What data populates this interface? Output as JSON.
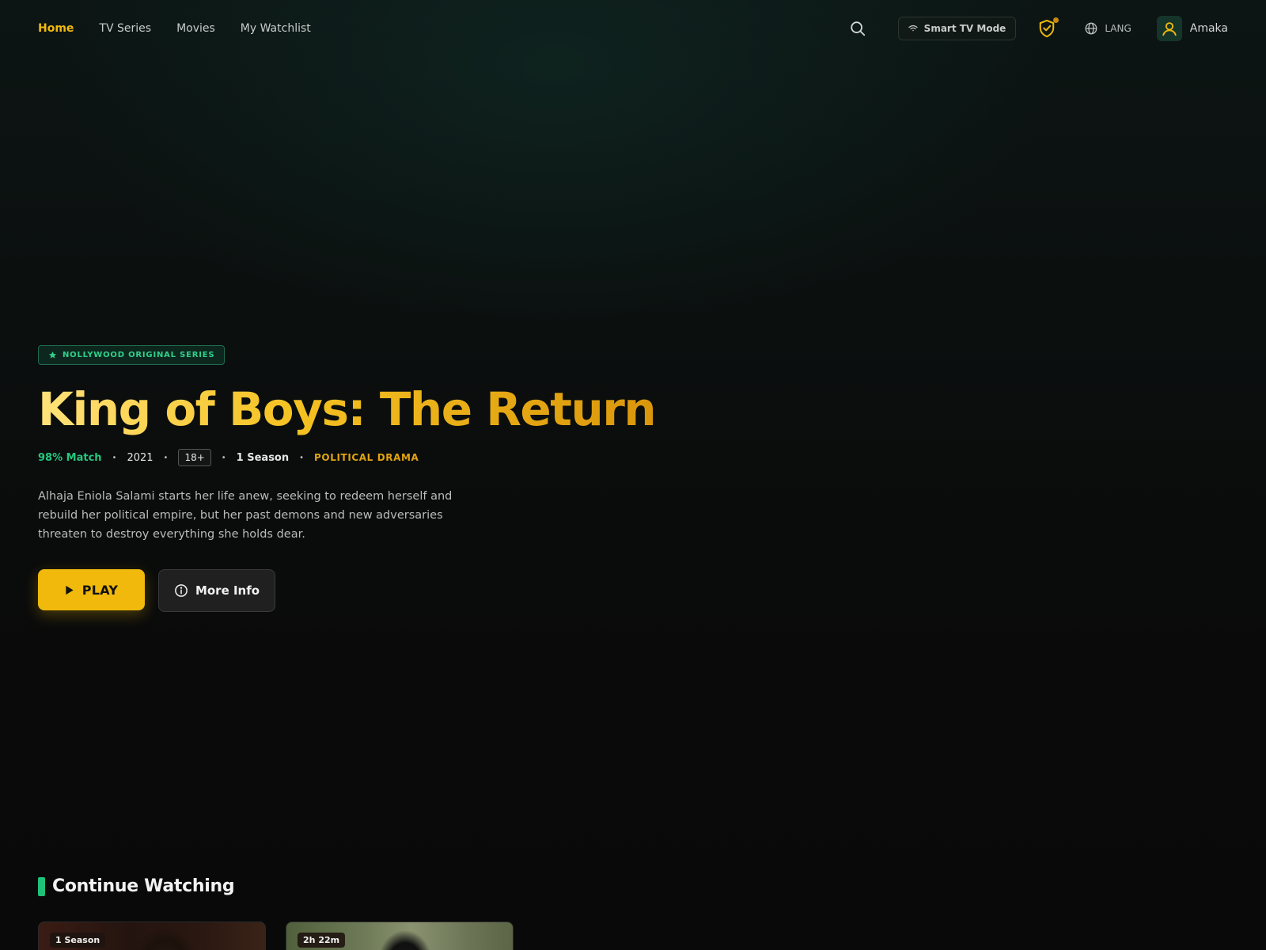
{
  "nav": {
    "items": [
      {
        "label": "Home",
        "active": true
      },
      {
        "label": "TV Series",
        "active": false
      },
      {
        "label": "Movies",
        "active": false
      },
      {
        "label": "My Watchlist",
        "active": false
      }
    ]
  },
  "header": {
    "search_icon": "search-icon",
    "tv_mode_label": "Smart TV Mode",
    "tv_mode_icon": "wifi-icon",
    "shield_icon": "shield-check-icon",
    "lang_label": "LANG",
    "lang_icon": "globe-icon",
    "user_name": "Amaka",
    "avatar_icon": "user-icon"
  },
  "hero": {
    "badge": "NOLLYWOOD ORIGINAL SERIES",
    "badge_icon": "star-icon",
    "title": "King of Boys: The Return",
    "match": "98% Match",
    "year": "2021",
    "rating": "18+",
    "seasons": "1 Season",
    "genre": "POLITICAL DRAMA",
    "description": "Alhaja Eniola Salami starts her life anew, seeking to redeem herself and rebuild her political empire, but her past demons and new adversaries threaten to destroy everything she holds dear.",
    "play_label": "PLAY",
    "info_label": "More Info"
  },
  "continue_watching": {
    "title": "Continue Watching",
    "cards": [
      {
        "tag": "1 Season"
      },
      {
        "tag": "2h 22m"
      }
    ]
  },
  "colors": {
    "accent": "#f0b90b",
    "green": "#1fc17a",
    "background": "#0a0a0a"
  }
}
